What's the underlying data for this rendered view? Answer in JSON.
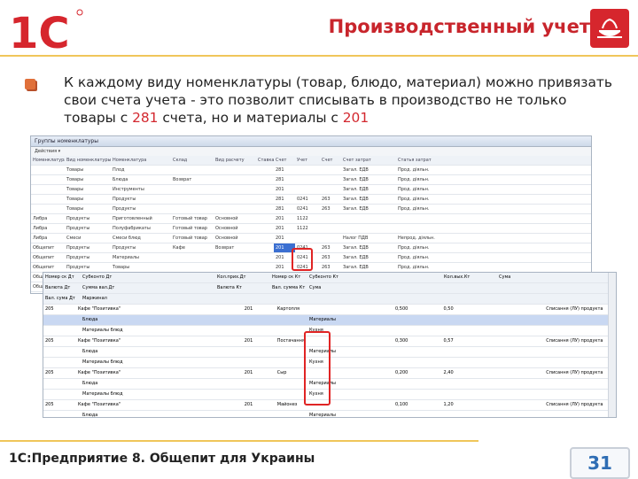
{
  "logo_text": "1С",
  "title": "Производственный учет",
  "body": {
    "part1": "К каждому виду номенклатуры (товар, блюдо, материал) можно привязать свои счета учета - это позволит списывать в производство не только товары с ",
    "num1": "281",
    "part2": " счета, но и материалы с ",
    "num2": "201"
  },
  "window1": {
    "title": "Группы номенклатуры",
    "toolbar": "Действия ▾",
    "headers": [
      "Номенклатура",
      "Вид номенклатуры",
      "Номенклатура",
      "Склад",
      "Вид расчету",
      "Ставка",
      "Счет",
      "Учет",
      "Счет",
      "Счет затрат",
      "Статья затрат"
    ],
    "rows": [
      [
        "",
        "Товары",
        "Плод",
        "",
        "",
        "",
        "281",
        "",
        "",
        "Загал. ЕДВ",
        "Прод. діяльн."
      ],
      [
        "",
        "Товары",
        "Блюда",
        "Возврат",
        "",
        "",
        "281",
        "",
        "",
        "Загал. ЕДВ",
        "Прод. діяльн."
      ],
      [
        "",
        "Товары",
        "Инструменты",
        "",
        "",
        "",
        "201",
        "",
        "",
        "Загал. ЕДВ",
        "Прод. діяльн."
      ],
      [
        "",
        "Товары",
        "Продукты",
        "",
        "",
        "",
        "281",
        "0241",
        "263",
        "Загал. ЕДВ",
        "Прод. діяльн."
      ],
      [
        "",
        "Товары",
        "Продукты",
        "",
        "",
        "",
        "281",
        "0241",
        "263",
        "Загал. ЕДВ",
        "Прод. діяльн."
      ],
      [
        "Либра",
        "Продукты",
        "Приготовленный",
        "Готовый товар",
        "Основной",
        "",
        "201",
        "1122",
        "",
        "",
        ""
      ],
      [
        "Либра",
        "Продукты",
        "Полуфабрикаты",
        "Готовый товар",
        "Основной",
        "",
        "201",
        "1122",
        "",
        "",
        ""
      ],
      [
        "Либра",
        "Смеси",
        "Смеси блюд",
        "Готовый товар",
        "Основной",
        "",
        "201",
        "",
        "",
        "Налог ПДВ",
        "Непрод. діяльн."
      ],
      [
        "Общепит",
        "Продукты",
        "Продукты",
        "Кафе",
        "Возврат",
        "",
        "201",
        "0241",
        "263",
        "Загал. ЕДВ",
        "Прод. діяльн."
      ],
      [
        "Общепит",
        "Продукты",
        "Материалы",
        "",
        "",
        "",
        "201",
        "0241",
        "263",
        "Загал. ЕДВ",
        "Прод. діяльн."
      ],
      [
        "Общепит",
        "Продукты",
        "Товары",
        "",
        "",
        "",
        "201",
        "0241",
        "263",
        "Загал. ЕДВ",
        "Прод. діяльн."
      ],
      [
        "Общепит",
        "Продукты",
        "Материалы",
        "",
        "",
        "",
        "201",
        "0241",
        "263",
        "Загал. ЕДВ",
        "Прод. діяльн."
      ],
      [
        "Общепит",
        "Продукты",
        "Товары",
        "",
        "",
        "",
        "201",
        "0241",
        "263",
        "Загал. ЕДВ",
        "Прод. діяльн."
      ]
    ]
  },
  "window2": {
    "headers": [
      "Номер ск Дт",
      "Субконто Дт",
      "Кол.прих.Дт",
      "Номер ск Кт",
      "Субконто Кт",
      "Кол.вых.Кт",
      "Сума"
    ],
    "subheaders": [
      [
        "Валюта Дт",
        "Сумма вал.Дт",
        "Валюта Кт",
        "Вал. сумма Кт",
        "Сума"
      ],
      [
        "Вал. сума Дт",
        "Маржинал"
      ]
    ],
    "rows": [
      [
        "205",
        "Кафе \"Позитивка\"",
        "",
        "201",
        "Картопля",
        "0,500",
        "0,50"
      ],
      [
        "",
        "Блюда",
        "",
        "",
        "Материалы",
        "",
        ""
      ],
      [
        "",
        "Материалы блюд",
        "",
        "",
        "Кухня",
        "",
        ""
      ],
      [
        "205",
        "Кафе \"Позитивка\"",
        "",
        "201",
        "Постачання",
        "0,300",
        "0,57"
      ],
      [
        "",
        "Блюда",
        "",
        "",
        "Материалы",
        "",
        ""
      ],
      [
        "",
        "Материалы блюд",
        "",
        "",
        "Кухня",
        "",
        ""
      ],
      [
        "205",
        "Кафе \"Позитивка\"",
        "",
        "201",
        "Сыр",
        "0,200",
        "2,40"
      ],
      [
        "",
        "Блюда",
        "",
        "",
        "Материалы",
        "",
        ""
      ],
      [
        "",
        "Материалы блюд",
        "",
        "",
        "Кухня",
        "",
        ""
      ],
      [
        "205",
        "Кафе \"Позитивка\"",
        "",
        "201",
        "Майонез",
        "0,100",
        "1,20"
      ],
      [
        "",
        "Блюда",
        "",
        "",
        "Материалы",
        "",
        ""
      ],
      [
        "",
        "Материалы блюд",
        "",
        "",
        "Кухня",
        "",
        ""
      ]
    ],
    "spisanie": "Списання (ЛУ) продукта"
  },
  "footer": "1С:Предприятие 8. Общепит для Украины",
  "page_number": "31",
  "colors": {
    "accent_red": "#c8252c",
    "rule_yellow": "#f0c65a",
    "page_blue": "#2e6db4"
  }
}
